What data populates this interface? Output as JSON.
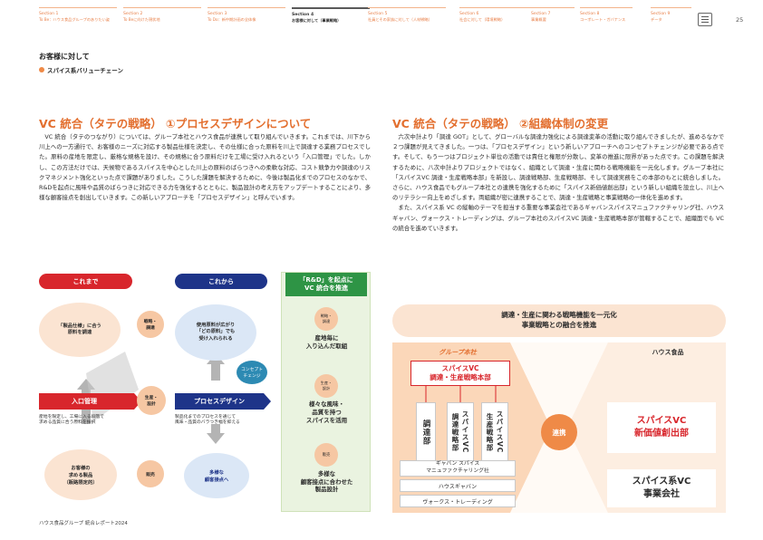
{
  "nav": [
    {
      "section": "Section 1",
      "text": "To Be：ハウス食品グループのありたい姿"
    },
    {
      "section": "Section 2",
      "text": "To Beに向けた現状地"
    },
    {
      "section": "Section 3",
      "text": "To Do：新中期計画の全体像"
    },
    {
      "section": "Section 4",
      "text": "お客様に対して（事業戦略）"
    },
    {
      "section": "Section 5",
      "text": "社員とその家族に対して（人材戦略）"
    },
    {
      "section": "Section 6",
      "text": "社会に対して（環境戦略）"
    },
    {
      "section": "Section 7",
      "text": "事業概要"
    },
    {
      "section": "Section 8",
      "text": "コーポレート・ガバナンス"
    },
    {
      "section": "Section 9",
      "text": "データ"
    }
  ],
  "page_number": "25",
  "header": {
    "title": "お客様に対して",
    "subtitle": "スパイス系バリューチェーン"
  },
  "left": {
    "title": "VC 統合（タテの戦略） ①プロセスデザインについて",
    "body": "VC 統合（タテのつながり）については、グループ本社とハウス食品が連携して取り組んでいきます。これまでは、川下から川上への一方通行で、お客様のニーズに対応する製品仕様を決定し、その仕様に合った原料を川上で調達する業務プロセスでした。原料の産地を限定し、厳格な規格を設け、その規格に合う原料だけを工場に受け入れるという「入口管理」でした。しかし、この方法だけでは、天候物であるスパイスを中心とした川上の原料のばらつきへの柔軟な対応、コスト競争力や調達のリスクマネジメント強化といった点で課題がありました。こうした課題を解決するために、今後は製品化までのプロセスのなかで、R&Dを起点に風味や品質のばらつきに対応できる力を強化するとともに、製品設計の考え方をアップデートすることにより、多様な顧客接点を創出していきます。この新しいアプローチを「プロセスデザイン」と呼んでいます。"
  },
  "diagram_left": {
    "before_label": "これまで",
    "after_label": "これから",
    "rd_label": "「R&D」を起点に\nVC 統合を推進",
    "spec_circle": "「製品仕様」に合う\n原料を調達",
    "procure_small": "戦略・\n調達",
    "raw_circle": "使用原料が広がり\n「どの原料」でも\n受け入れられる",
    "concept_label": "コンセプト\nチェンジ",
    "entry_label": "入口管理",
    "entry_desc": "産地を限定し、工場に入る段階で\n求める品質に合う原料を採択",
    "mfg_small": "生産・\n設計",
    "process_label": "プロセスデザイン",
    "process_desc": "製品化までのプロセスを通じて\n風味・品質のバラつき幅を抑える",
    "customer_circle": "お客様の\n求める製品\n（販路限定的）",
    "sales_small": "販売",
    "touch_circle": "多様な\n顧客接点へ",
    "rd_items": [
      {
        "tag": "戦略・\n調達",
        "text": "産地毎に\n入り込んだ取組"
      },
      {
        "tag": "生産・\n設計",
        "text": "様々な風味・\n品質を持つ\nスパイスを活用"
      },
      {
        "tag": "販売",
        "text": "多様な\n顧客接点に合わせた\n製品設計"
      }
    ]
  },
  "right": {
    "title": "VC 統合（タテの戦略） ②組織体制の変更",
    "para1": "六次中計より「調達 GOT」として、グローバルな調達力強化による調達変革の活動に取り組んできましたが、進めるなかで２つ課題が見えてきました。一つは、「プロセスデザイン」という新しいアプローチへのコンセプトチェンジが必要である点です。そして、もう一つはプロジェクト単位の活動では責任と権限が分散し、変革の推進に限界があった点です。この課題を解決するために、八次中計よりプロジェクトではなく、組織として調達・生産に関わる戦略機能を一元化します。グループ本社に「スパイスVC 調達・生産戦略本部」を新設し、調達戦略部、生産戦略部、そして調達実務をこの本部のもとに統合しました。さらに、ハウス食品でもグループ本社との連携を強化するために「スパイス新価値創出部」という新しい組織を設立し、川上へのリテラシー向上をめざします。両組織が密に連携することで、調達・生産戦略と事業戦略の一体化を進めます。",
    "para2": "また、スパイス系 VC の縦軸のテーマを担当する重要な事業会社であるギャバンスパイスマニュファクチャリング社、ハウスギャバン、ヴォークス・トレーディングは、グループ本社のスパイスVC 調達・生産戦略本部が管轄することで、組織面でも VC の統合を進めていきます。"
  },
  "diagram_right": {
    "banner": "調達・生産に関わる戦略機能を一元化\n事業戦略との融合を推進",
    "group_hq": "グループ本社",
    "house_foods": "ハウス食品",
    "hq_box": "スパイスVC\n調達・生産戦略本部",
    "sub_units": [
      "調達部",
      "スパイスVC\n調達戦略部",
      "スパイスVC\n生産戦略部"
    ],
    "companies": [
      "ギャバン スパイス\nマニュファクチャリング社",
      "ハウスギャバン",
      "ヴォークス・トレーディング"
    ],
    "link": "連携",
    "new_dept": "スパイスVC\n新価値創出部",
    "business_co": "スパイス系VC\n事業会社"
  },
  "footer": "ハウス食品グループ 統合レポート2024",
  "colors": {
    "orange": "#e36f2f",
    "red": "#d8262c",
    "navy": "#1e3489",
    "light_orange": "#fbe4d2",
    "light_blue": "#dbe7f6"
  }
}
